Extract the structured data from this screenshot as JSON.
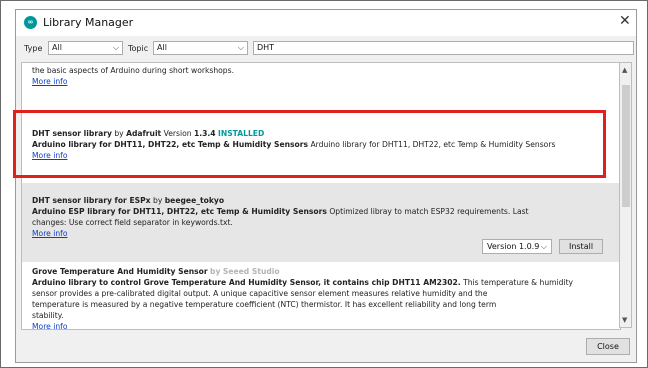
{
  "window": {
    "title": "Library Manager",
    "app_icon_text": "∞"
  },
  "filter": {
    "type_label": "Type",
    "type_value": "All",
    "topic_label": "Topic",
    "topic_value": "All",
    "search_value": "DHT"
  },
  "entries": [
    {
      "description": "the basic aspects of Arduino during short workshops.",
      "more_info": "More info"
    },
    {
      "name": "DHT sensor library",
      "by": "by",
      "author": "Adafruit",
      "version_label": "Version",
      "version": "1.3.4",
      "status": "INSTALLED",
      "summary": "Arduino library for DHT11, DHT22, etc Temp & Humidity Sensors",
      "description": "Arduino library for DHT11, DHT22, etc Temp & Humidity Sensors",
      "more_info": "More info"
    },
    {
      "name": "DHT sensor library for ESPx",
      "by": "by",
      "author": "beegee_tokyo",
      "summary": "Arduino ESP library for DHT11, DHT22, etc Temp & Humidity Sensors",
      "description_line1": "Optimized libray to match ESP32 requirements. Last",
      "description_line2": "changes: Use correct field separator in keywords.txt.",
      "more_info": "More info",
      "version_select": "Version 1.0.9",
      "install_label": "Install"
    },
    {
      "name": "Grove Temperature And Humidity Sensor",
      "by": "by",
      "author": "Seeed Studio",
      "summary": "Arduino library to control Grove Temperature And Humidity Sensor, it contains chip DHT11 AM2302.",
      "description_line1": "This temperature & humidity",
      "description_line2": "sensor provides a pre-calibrated digital output. A unique capacitive sensor element measures relative humidity and the",
      "description_line3": "temperature is measured by a negative temperature coefficient (NTC) thermistor. It has excellent reliability and long term",
      "description_line4": "stability.",
      "more_info": "More info"
    }
  ],
  "footer": {
    "close_label": "Close"
  },
  "colors": {
    "highlight": "#e02020",
    "installed": "#00979c",
    "link": "#0d3fc7"
  }
}
